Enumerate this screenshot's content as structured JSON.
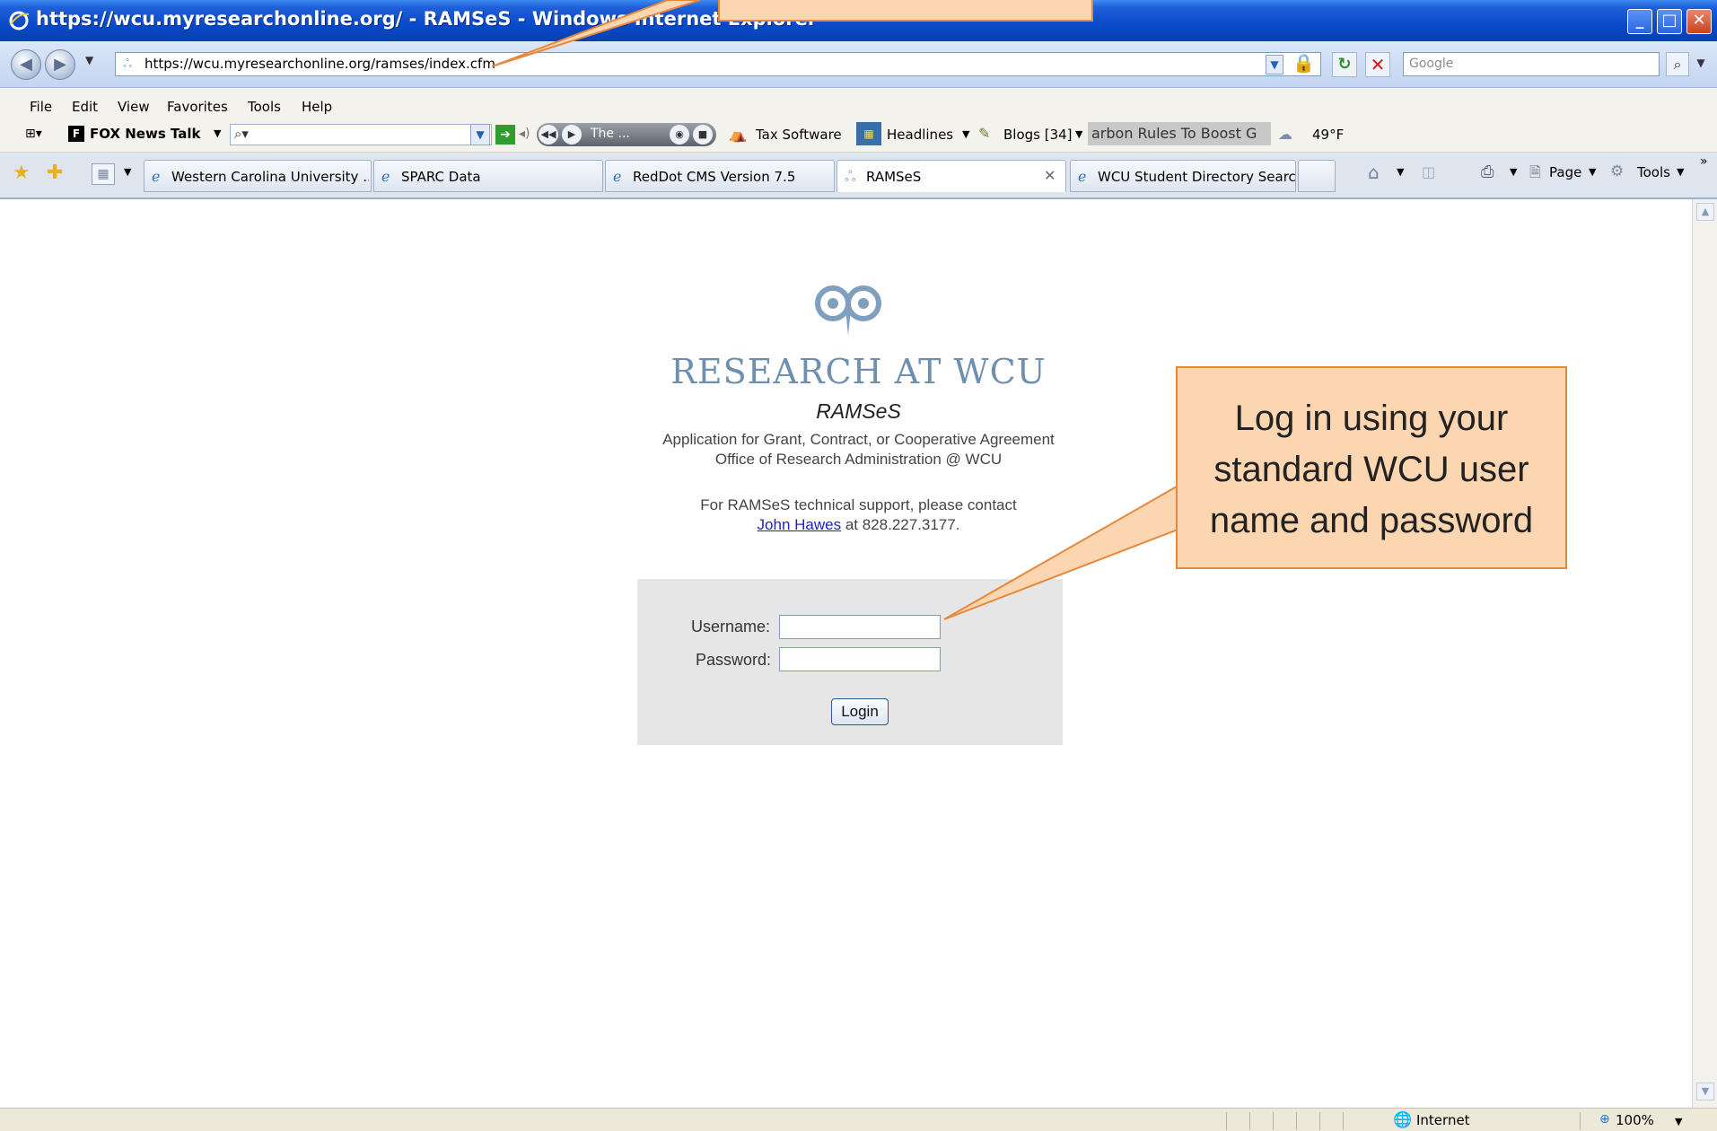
{
  "window": {
    "title": "https://wcu.myresearchonline.org/ - RAMSeS - Windows Internet Explorer"
  },
  "address_bar": {
    "url": "https://wcu.myresearchonline.org/ramses/index.cfm",
    "search_placeholder": "Google"
  },
  "menu": {
    "items": [
      "File",
      "Edit",
      "View",
      "Favorites",
      "Tools",
      "Help"
    ]
  },
  "toolbar": {
    "fox_label": "FOX News Talk",
    "media_label": "The ...",
    "tax_label": "Tax Software",
    "headlines_label": "Headlines",
    "blogs_label": "Blogs [34]",
    "news_ticker": "arbon Rules To Boost G",
    "weather": "49°F"
  },
  "tabs": [
    {
      "label": "Western Carolina University ..."
    },
    {
      "label": "SPARC Data"
    },
    {
      "label": "RedDot CMS Version 7.5"
    },
    {
      "label": "RAMSeS"
    },
    {
      "label": "WCU Student Directory Search"
    }
  ],
  "command_bar": {
    "page_label": "Page",
    "tools_label": "Tools"
  },
  "page": {
    "brand": "RESEARCH AT WCU",
    "app_name": "RAMSeS",
    "subtitle_1": "Application for Grant, Contract, or Cooperative Agreement",
    "subtitle_2": "Office of Research Administration @ WCU",
    "support_text": "For RAMSeS technical support, please contact",
    "support_contact": "John Hawes",
    "support_phone": "at 828.227.3177."
  },
  "login_form": {
    "username_label": "Username:",
    "password_label": "Password:",
    "username_value": "",
    "password_value": "",
    "submit_label": "Login"
  },
  "status_bar": {
    "zone": "Internet",
    "zoom": "100%"
  },
  "callouts": {
    "login_text_lines": [
      "Log in using your",
      "standard WCU user",
      "name and password"
    ]
  },
  "colors": {
    "titlebar": "#0a49c9",
    "brand_text": "#6e8fb0",
    "link": "#1f22c8",
    "callout_fill": "#fbd6b0",
    "callout_border": "#e7883a",
    "login_panel": "#e6e6e6"
  }
}
